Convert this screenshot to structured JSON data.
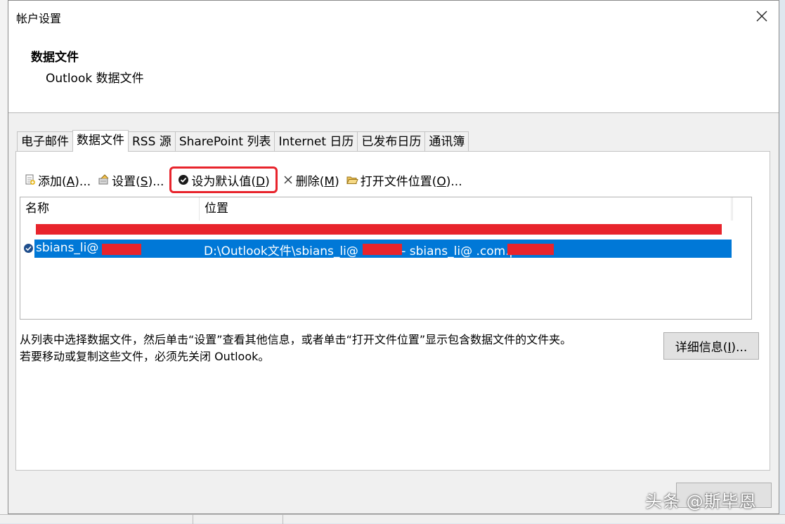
{
  "window": {
    "title": "帐户设置",
    "close_glyph": "✕"
  },
  "header": {
    "title": "数据文件",
    "subtitle": "Outlook 数据文件"
  },
  "tabs": [
    {
      "label": "电子邮件",
      "active": false
    },
    {
      "label": "数据文件",
      "active": true
    },
    {
      "label": "RSS 源",
      "active": false
    },
    {
      "label": "SharePoint 列表",
      "active": false
    },
    {
      "label": "Internet 日历",
      "active": false
    },
    {
      "label": "已发布日历",
      "active": false
    },
    {
      "label": "通讯簿",
      "active": false
    }
  ],
  "toolbar": {
    "add": {
      "text": "添加(",
      "key": "A",
      "tail": ")...",
      "icon": "add-file-icon"
    },
    "settings": {
      "text": "设置(",
      "key": "S",
      "tail": ")...",
      "icon": "settings-icon"
    },
    "set_default": {
      "text": "设为默认值(",
      "key": "D",
      "tail": ")",
      "icon": "check-circle-icon"
    },
    "remove": {
      "text": "删除(",
      "key": "M",
      "tail": ")",
      "icon": "remove-x-icon"
    },
    "open_location": {
      "text": "打开文件位置(",
      "key": "O",
      "tail": ")...",
      "icon": "folder-open-icon"
    }
  },
  "list": {
    "columns": [
      "名称",
      "位置"
    ],
    "rows": [
      {
        "name": "",
        "location": "",
        "redacted": true
      },
      {
        "name": "sbians_li@       .com",
        "location": "D:\\Outlook文件\\sbians_li@       s.com - sbians_li@              .com.pst",
        "selected": true,
        "default": true
      }
    ]
  },
  "hint": {
    "line1": "从列表中选择数据文件，然后单击“设置”查看其他信息，或者单击“打开文件位置”显示包含数据文件的文件夹。",
    "line2": "若要移动或复制这些文件，必须先关闭 Outlook。"
  },
  "details_button": {
    "text": "详细信息(",
    "key": "I",
    "tail": ")..."
  },
  "watermark": "头条 @斯毕恩",
  "colors": {
    "selection": "#0078d7",
    "highlight_outline": "#e8242c",
    "redaction": "#e8242c"
  }
}
